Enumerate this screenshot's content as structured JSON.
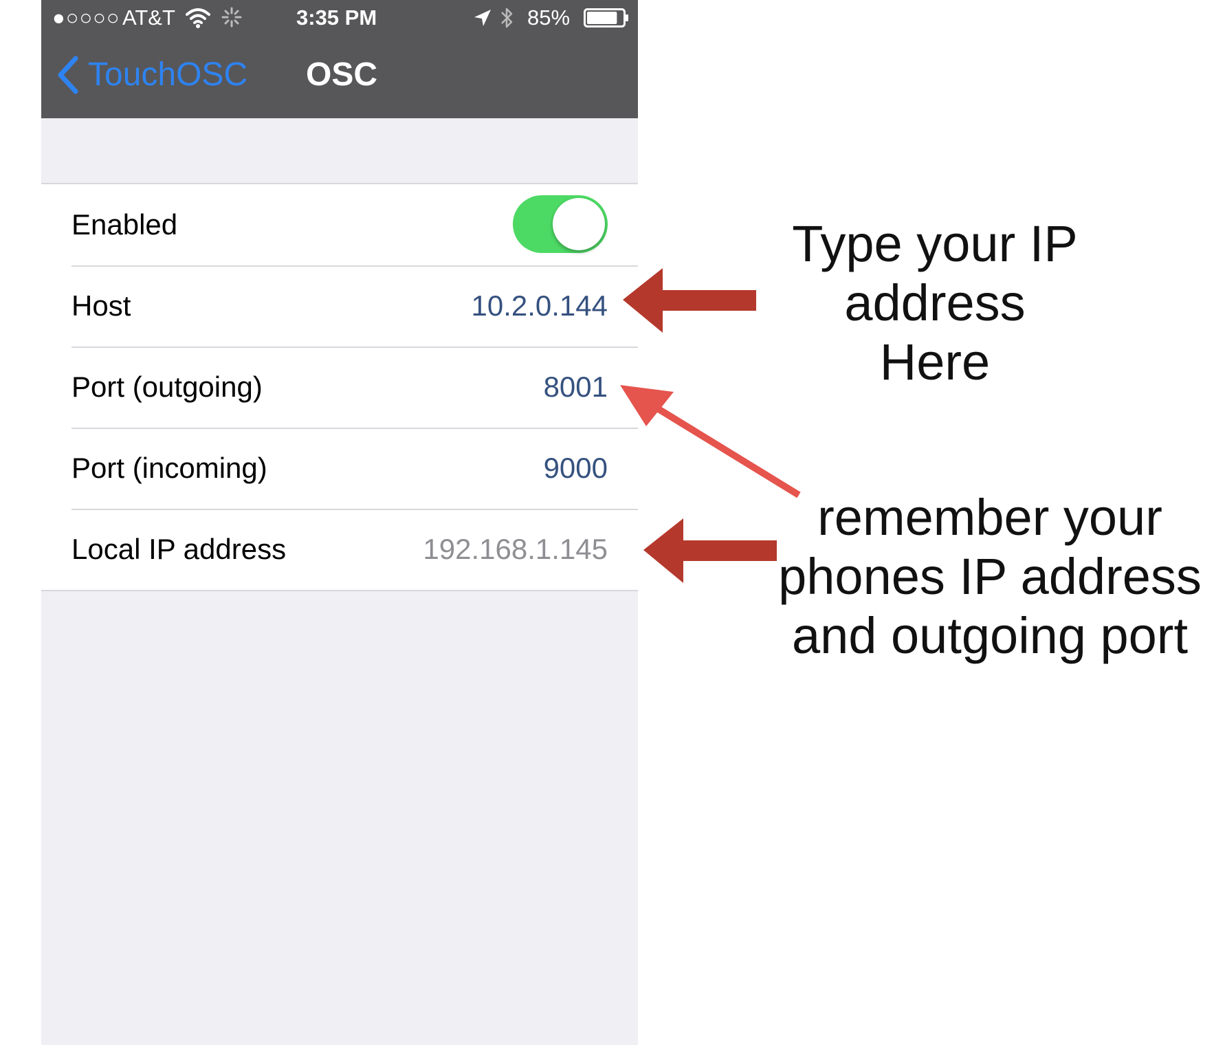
{
  "status_bar": {
    "signal": "●○○○○",
    "carrier": "AT&T",
    "time": "3:35 PM",
    "battery_percent": "85%",
    "battery_level": 0.85,
    "icons": [
      "wifi-icon",
      "activity-icon",
      "location-icon",
      "bluetooth-icon",
      "battery-icon"
    ]
  },
  "nav": {
    "back_label": "TouchOSC",
    "title": "OSC"
  },
  "settings": {
    "enabled": {
      "label": "Enabled",
      "value": true
    },
    "host": {
      "label": "Host",
      "value": "10.2.0.144"
    },
    "port_outgoing": {
      "label": "Port (outgoing)",
      "value": "8001"
    },
    "port_incoming": {
      "label": "Port (incoming)",
      "value": "9000"
    },
    "local_ip": {
      "label": "Local IP address",
      "value": "192.168.1.145"
    }
  },
  "annotations": {
    "ip_note": "Type your IP\naddress\nHere",
    "remember_note": "remember your\nphones IP address\nand outgoing port"
  },
  "colors": {
    "nav_background": "#575759",
    "accent_blue": "#2e83f1",
    "toggle_on": "#4cd964",
    "value_blue": "#35517f",
    "arrow_dark": "#b5382c",
    "arrow_light": "#e5544d"
  }
}
